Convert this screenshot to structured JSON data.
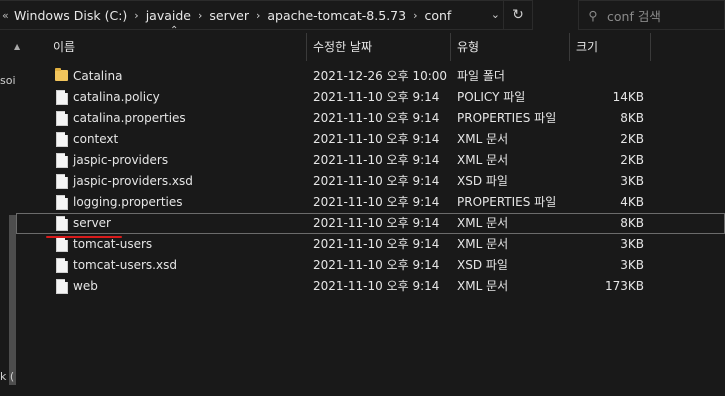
{
  "address_bar": {
    "segments": [
      "Windows Disk (C:)",
      "javaide",
      "server",
      "apache-tomcat-8.5.73",
      "conf"
    ]
  },
  "search": {
    "placeholder": "conf 검색"
  },
  "nav_pane": {
    "clipped_text_top": "soi",
    "clipped_text_bottom": "k ("
  },
  "columns": {
    "name": "이름",
    "date": "수정한 날짜",
    "type": "유형",
    "size": "크기"
  },
  "files": [
    {
      "name": "Catalina",
      "date": "2021-12-26 오후 10:00",
      "type": "파일 폴더",
      "size": "",
      "kind": "folder"
    },
    {
      "name": "catalina.policy",
      "date": "2021-11-10 오후 9:14",
      "type": "POLICY 파일",
      "size": "14KB",
      "kind": "file"
    },
    {
      "name": "catalina.properties",
      "date": "2021-11-10 오후 9:14",
      "type": "PROPERTIES 파일",
      "size": "8KB",
      "kind": "file"
    },
    {
      "name": "context",
      "date": "2021-11-10 오후 9:14",
      "type": "XML 문서",
      "size": "2KB",
      "kind": "file"
    },
    {
      "name": "jaspic-providers",
      "date": "2021-11-10 오후 9:14",
      "type": "XML 문서",
      "size": "2KB",
      "kind": "file"
    },
    {
      "name": "jaspic-providers.xsd",
      "date": "2021-11-10 오후 9:14",
      "type": "XSD 파일",
      "size": "3KB",
      "kind": "file"
    },
    {
      "name": "logging.properties",
      "date": "2021-11-10 오후 9:14",
      "type": "PROPERTIES 파일",
      "size": "4KB",
      "kind": "file"
    },
    {
      "name": "server",
      "date": "2021-11-10 오후 9:14",
      "type": "XML 문서",
      "size": "8KB",
      "kind": "file",
      "selected": true
    },
    {
      "name": "tomcat-users",
      "date": "2021-11-10 오후 9:14",
      "type": "XML 문서",
      "size": "3KB",
      "kind": "file"
    },
    {
      "name": "tomcat-users.xsd",
      "date": "2021-11-10 오후 9:14",
      "type": "XSD 파일",
      "size": "3KB",
      "kind": "file"
    },
    {
      "name": "web",
      "date": "2021-11-10 오후 9:14",
      "type": "XML 문서",
      "size": "173KB",
      "kind": "file"
    }
  ],
  "colors": {
    "background": "#191919",
    "annotation_underline": "#d81b1b",
    "folder": "#f2c55c"
  }
}
